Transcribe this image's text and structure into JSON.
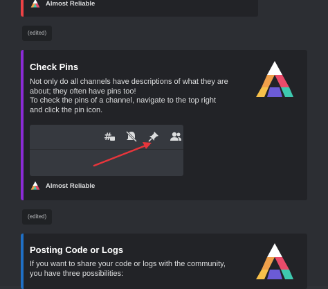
{
  "cards": [
    {
      "accent": "#ed4245",
      "footer_text": "Almost Reliable"
    },
    {
      "accent": "#8b2bd6",
      "title": "Check Pins",
      "description_lines": [
        "Not only do all channels have descriptions of what they are",
        "about; they often have pins too!",
        "To check the pins of a channel, navigate to the top right",
        "and click the pin icon."
      ],
      "footer_text": "Almost Reliable",
      "screenshot_icons": [
        "threads-icon",
        "muted-bell-icon",
        "pin-icon",
        "members-icon"
      ]
    },
    {
      "accent": "#1f6fc5",
      "title": "Posting Code or Logs",
      "description_lines": [
        "If you want to share your code or logs with the community,",
        "you have three possibilities:"
      ]
    }
  ],
  "edited_labels": [
    "(edited)",
    "(edited)"
  ],
  "colors": {
    "arrow": "#e8353b",
    "logo_top": "#ffffff",
    "logo_left": "#f0a04b",
    "logo_right": "#e94b6a",
    "logo_base": "#3ec9b0"
  }
}
